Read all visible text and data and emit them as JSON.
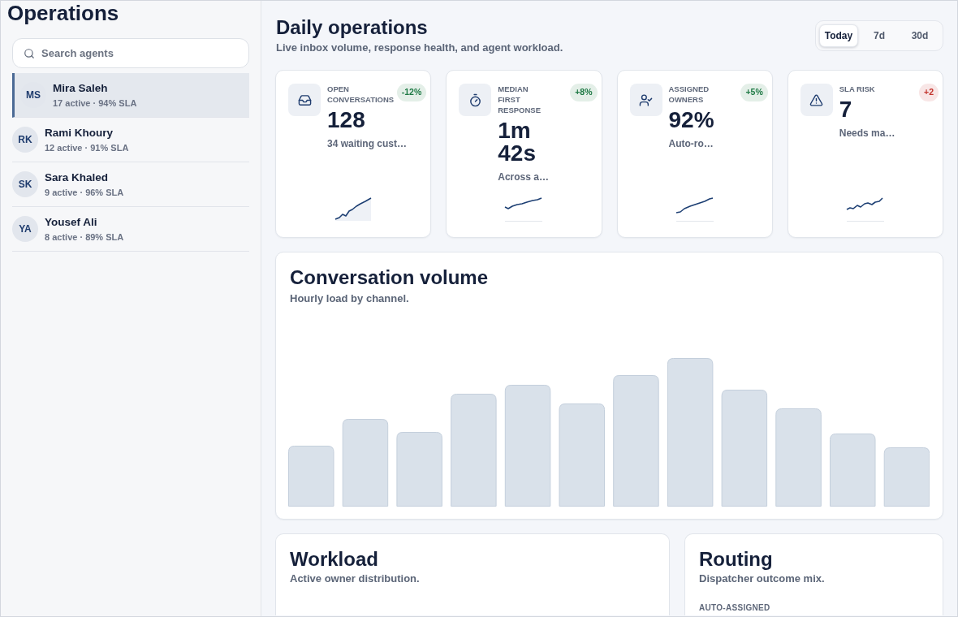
{
  "sidebar": {
    "title": "Operations",
    "search": {
      "placeholder": "Search agents"
    },
    "agents": [
      {
        "initials": "MS",
        "name": "Mira Saleh",
        "stats": "17 active · 94% SLA",
        "selected": true
      },
      {
        "initials": "RK",
        "name": "Rami Khoury",
        "stats": "12 active · 91% SLA",
        "selected": false
      },
      {
        "initials": "SK",
        "name": "Sara Khaled",
        "stats": "9 active · 96% SLA",
        "selected": false
      },
      {
        "initials": "YA",
        "name": "Yousef Ali",
        "stats": "8 active · 89% SLA",
        "selected": false
      }
    ]
  },
  "header": {
    "title": "Daily operations",
    "subtitle": "Live inbox volume, response health, and agent workload.",
    "ranges": [
      {
        "label": "Today",
        "selected": true
      },
      {
        "label": "7d",
        "selected": false
      },
      {
        "label": "30d",
        "selected": false
      }
    ]
  },
  "kpis": [
    {
      "label": "OPEN CONVERSATIONS",
      "value": "128",
      "note": "34 waiting cust…",
      "badge": {
        "text": "-12%",
        "color": "#1f7a45"
      },
      "sparkline": {
        "kind": "area"
      }
    },
    {
      "label": "MEDIAN FIRST RESPONSE",
      "value": "1m 42s",
      "note": "Across a…",
      "badge": {
        "text": "+8%",
        "color": "#1f7a45"
      },
      "sparkline": {
        "kind": "line"
      }
    },
    {
      "label": "ASSIGNED OWNERS",
      "value": "92%",
      "note": "Auto-ro…",
      "badge": {
        "text": "+5%",
        "color": "#1f7a45"
      },
      "sparkline": {
        "kind": "line"
      }
    },
    {
      "label": "SLA RISK",
      "value": "7",
      "note": "Needs ma…",
      "badge": {
        "text": "+2",
        "color": "#c3352e"
      },
      "sparkline": {
        "kind": "line"
      }
    }
  ],
  "volume": {
    "title": "Conversation volume",
    "subtitle": "Hourly load by channel."
  },
  "workload": {
    "title": "Workload",
    "subtitle": "Active owner distribution."
  },
  "routing": {
    "title": "Routing",
    "subtitle": "Dispatcher outcome mix.",
    "outcomes": [
      {
        "label": "AUTO-ASSIGNED"
      }
    ]
  }
}
